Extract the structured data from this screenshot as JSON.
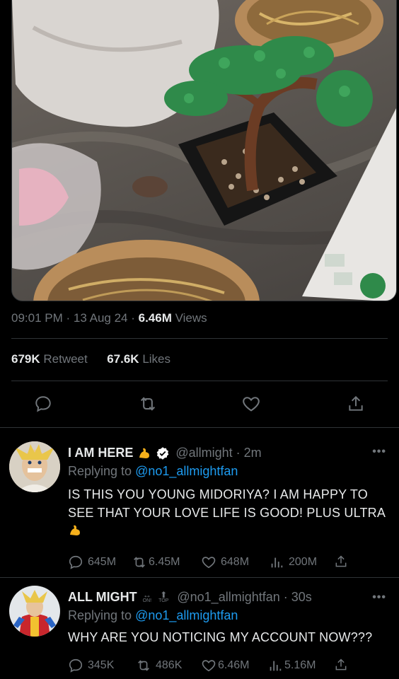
{
  "tweet": {
    "time": "09:01 PM",
    "date": "13 Aug 24",
    "views_count": "6.46M",
    "views_label": "Views",
    "retweets_count": "679K",
    "retweets_label": "Retweet",
    "likes_count": "67.6K",
    "likes_label": "Likes",
    "separator": "·"
  },
  "replies": [
    {
      "name": "I AM HERE",
      "handle": "@allmight",
      "time": "2m",
      "replying_prefix": "Replying to",
      "replying_to": "@no1_allmightfan",
      "text": "IS THIS YOU YOUNG MIDORIYA? I AM HAPPY TO SEE THAT YOUR LOVE LIFE IS GOOD! PLUS ULTRA",
      "replies": "645M",
      "retweets": "6.45M",
      "likes": "648M",
      "views": "200M"
    },
    {
      "name": "ALL MIGHT",
      "handle": "@no1_allmightfan",
      "time": "30s",
      "replying_prefix": "Replying to",
      "replying_to": "@no1_allmightfan",
      "text": "WHY ARE YOU NOTICING MY ACCOUNT NOW???",
      "badge_on": "ON!",
      "badge_top": "TOP",
      "replies": "345K",
      "retweets": "486K",
      "likes": "6.46M",
      "views": "5.16M"
    }
  ],
  "icons": {
    "reply": "reply-icon",
    "retweet": "retweet-icon",
    "like": "heart-icon",
    "share": "share-icon",
    "views": "views-icon",
    "verified": "verified-badge-icon",
    "more": "more-icon"
  },
  "colors": {
    "background": "#000000",
    "text": "#e7e9ea",
    "muted": "#71767b",
    "accent": "#1d9bf0",
    "divider": "#2f3336"
  }
}
